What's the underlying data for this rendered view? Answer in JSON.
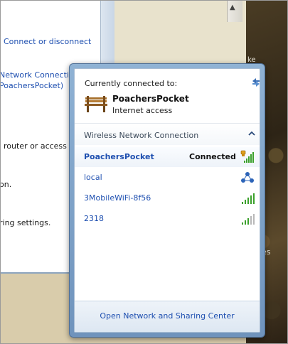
{
  "background_window": {
    "connect_link": "Connect or disconnect",
    "network_conn_line1": "Network Connectio",
    "network_conn_line2": "PoachersPocket)",
    "router_text": "router or access po",
    "on_text": "on.",
    "settings_text": "ring settings."
  },
  "photo": {
    "text_es": "es",
    "text_ke": "ke"
  },
  "flyout": {
    "current_label": "Currently connected to:",
    "current_network": "PoachersPocket",
    "current_status": "Internet access",
    "section_title": "Wireless Network Connection",
    "networks": [
      {
        "name": "PoachersPocket",
        "status": "Connected",
        "signal": "5-bars-secured"
      },
      {
        "name": "local",
        "status": "",
        "signal": "ad-hoc"
      },
      {
        "name": "3MobileWiFi-8f56",
        "status": "",
        "signal": "5-bars"
      },
      {
        "name": "2318",
        "status": "",
        "signal": "3-bars"
      }
    ],
    "footer_link": "Open Network and Sharing Center"
  },
  "colors": {
    "link": "#1e4fb0",
    "signal_green": "#3aa02a",
    "flyout_border": "#6f93bc"
  }
}
